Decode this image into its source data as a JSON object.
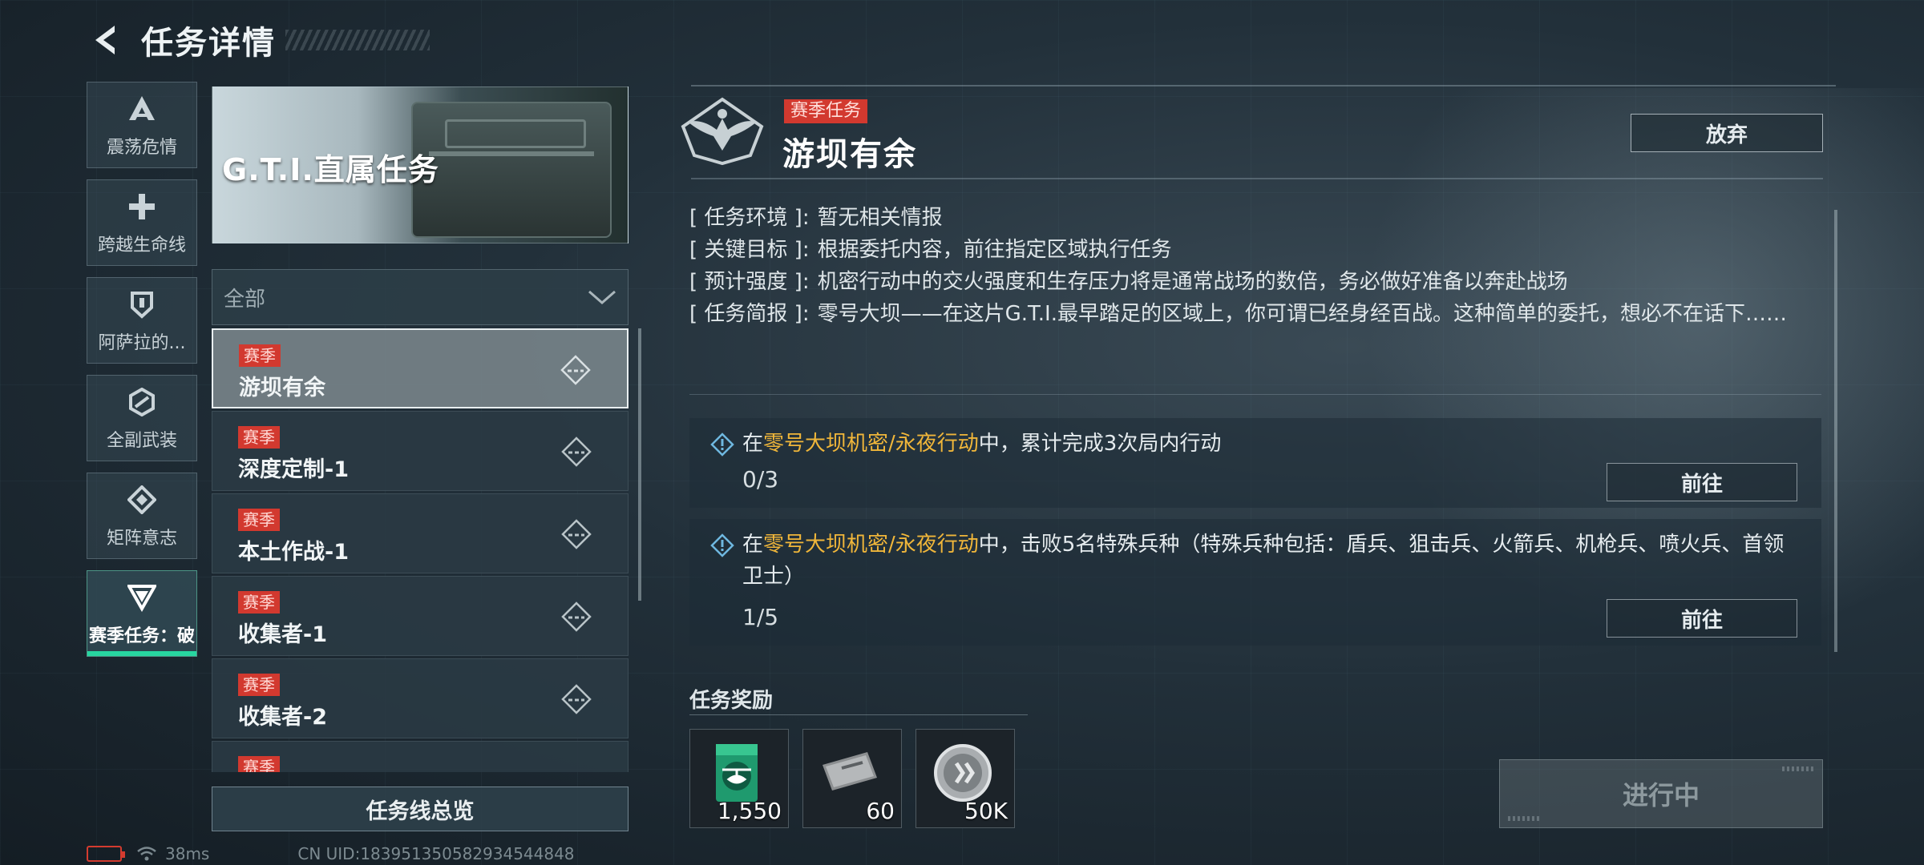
{
  "header": {
    "title": "任务详情"
  },
  "categories": [
    {
      "label": "震荡危情",
      "icon": "triangle-a-icon"
    },
    {
      "label": "跨越生命线",
      "icon": "cross-icon"
    },
    {
      "label": "阿萨拉的...",
      "icon": "shield-icon"
    },
    {
      "label": "全副武装",
      "icon": "hexagon-icon"
    },
    {
      "label": "矩阵意志",
      "icon": "diamond-icon"
    },
    {
      "label": "赛季任务：破",
      "icon": "chevron-down-triangle-icon",
      "active": true
    }
  ],
  "banner": {
    "title": "G.T.I.直属任务"
  },
  "filter": {
    "value": "全部"
  },
  "tasks": [
    {
      "tag": "赛季",
      "name": "游坝有余",
      "selected": true
    },
    {
      "tag": "赛季",
      "name": "深度定制-1"
    },
    {
      "tag": "赛季",
      "name": "本土作战-1"
    },
    {
      "tag": "赛季",
      "name": "收集者-1"
    },
    {
      "tag": "赛季",
      "name": "收集者-2"
    },
    {
      "tag": "赛季",
      "name": ""
    }
  ],
  "overview_button": "任务线总览",
  "status": {
    "latency": "38ms",
    "uid": "CN UID:1839513505829345448​48"
  },
  "mission": {
    "tag": "赛季任务",
    "title": "游坝有余",
    "abandon": "放弃",
    "info": [
      {
        "key": "[ 任务环境 ]:",
        "value": "暂无相关情报"
      },
      {
        "key": "[ 关键目标 ]:",
        "value": "根据委托内容，前往指定区域执行任务"
      },
      {
        "key": "[ 预计强度 ]:",
        "value": "机密行动中的交火强度和生存压力将是通常战场的数倍，务必做好准备以奔赴战场"
      },
      {
        "key": "[ 任务简报 ]:",
        "value": "零号大坝——在这片G.T.I.最早踏足的区域上，你可谓已经身经百战。这种简单的委托，想必不在话下……"
      }
    ],
    "objectives": [
      {
        "pre": "在",
        "highlight": "零号大坝机密/永夜行动",
        "post": "中，累计完成3次局内行动",
        "progress": "0/3",
        "button": "前往"
      },
      {
        "pre": "在",
        "highlight": "零号大坝机密/永夜行动",
        "post": "中，击败5名特殊兵种（特殊兵种包括：盾兵、狙击兵、火箭兵、机枪兵、喷火兵、首领卫士）",
        "progress": "1/5",
        "button": "前往"
      }
    ],
    "reward_title": "任务奖励",
    "rewards": [
      {
        "icon": "helicopter-badge-icon",
        "qty": "1,550"
      },
      {
        "icon": "ticket-icon",
        "qty": "60"
      },
      {
        "icon": "silver-coin-icon",
        "qty": "50K"
      }
    ],
    "status_button": "进行中"
  },
  "colors": {
    "accent": "#27d6a0",
    "tag_red": "#d2392f",
    "highlight": "#f0b63a"
  }
}
